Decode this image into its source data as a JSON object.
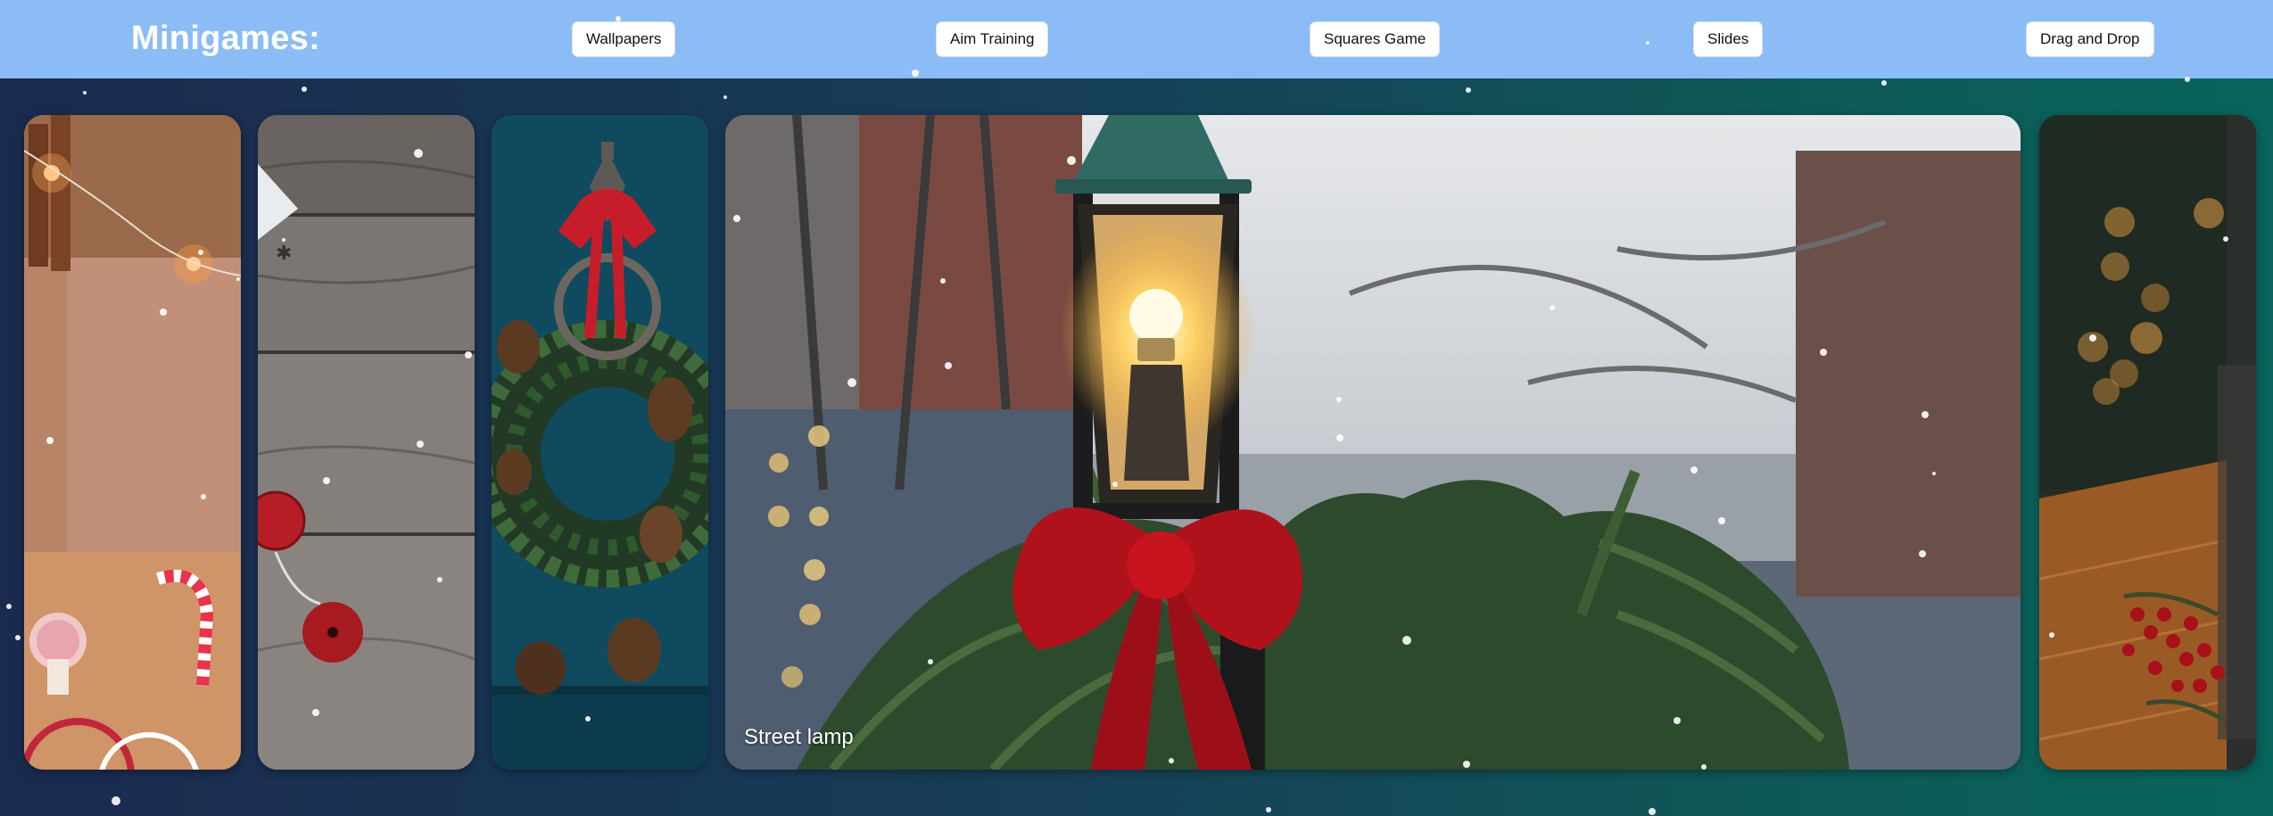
{
  "header": {
    "title": "Minigames:",
    "nav": [
      {
        "label": "Wallpapers"
      },
      {
        "label": "Aim Training"
      },
      {
        "label": "Squares Game"
      },
      {
        "label": "Slides"
      },
      {
        "label": "Drag and Drop"
      }
    ]
  },
  "gallery": {
    "active_caption": "Street lamp",
    "cards": [
      {
        "image": "gifts-candy-cane-lights"
      },
      {
        "image": "wood-planks-ornaments"
      },
      {
        "image": "wreath-on-door"
      },
      {
        "image": "street-lamp-with-bow"
      },
      {
        "image": "candle-berries-table"
      }
    ]
  },
  "colors": {
    "header_bg": "#8bbcf5",
    "page_gradient_start": "#1b2a4f",
    "page_gradient_end": "#07645a"
  }
}
